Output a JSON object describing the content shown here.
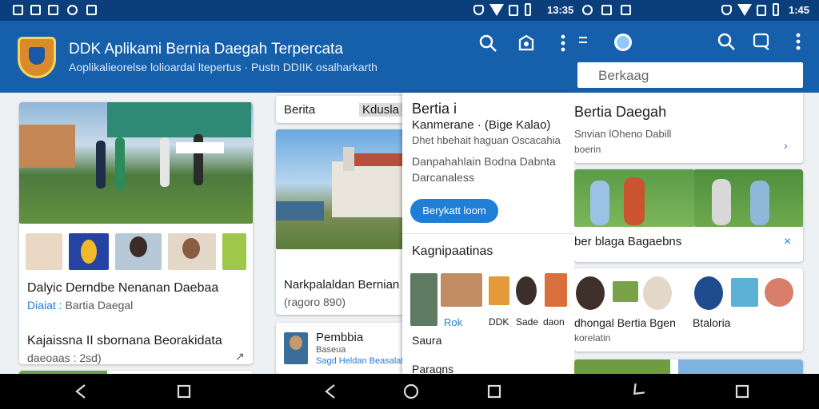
{
  "status_bar": {
    "time_mid": "13:35",
    "time_right": "1:45"
  },
  "panel1": {
    "app_title": "DDK Aplikami Bernia Daegah Terpercata",
    "app_subtitle": "Aoplikalieorelse lolioardal ltepertus · Pustn DDIIK osalharkarth",
    "card1": {
      "title": "Dalyic Derndbe Nenanan Daebaa",
      "meta_label": "Diaiat :",
      "meta_value": "Bartia Daegal"
    },
    "card2": {
      "title": "Kajaissna II sbornana Beorakidata",
      "meta": "daeoaas : 2sd)"
    }
  },
  "panel2": {
    "tabs": [
      {
        "label": "Berita"
      },
      {
        "label": "Kdusla"
      }
    ],
    "card1": {
      "title": "Narkpalaldan Bernian",
      "meta": "(ragoro  890)"
    },
    "card2": {
      "title": "Pembbia",
      "sub1": "Baseua",
      "sub2": "Sagd Heldan Beasalata"
    }
  },
  "panel3_drawer": {
    "title": "Bertia i",
    "subtitle": "Kanmerane · (Bige Kalao)",
    "line1": "Dhet hbehait haguan Oscacahia",
    "line2": "Danpahahlain Bodna Dabnta",
    "line3": "Darcanaless",
    "button_label": "Berykatt loom",
    "section_title": "Kagnipaatinas",
    "items": [
      {
        "label": ""
      },
      {
        "label": "Rok"
      },
      {
        "label": "DDK"
      },
      {
        "label": "Sade"
      },
      {
        "label": "daon"
      }
    ],
    "footer1": "Saura",
    "footer2": "Paragns"
  },
  "panel4": {
    "search_placeholder": "Berkaag",
    "card1": {
      "title": "Bertia Daegah",
      "line1": "Snvian  lOheno Dabill",
      "line2": "boerin"
    },
    "card2": {
      "title": "ber blaga Bagaebns"
    },
    "card3": {
      "title": "dhongal Bertia Bgen",
      "title2": "Btaloria",
      "sub": "korelatin"
    }
  },
  "colors": {
    "appbar": "#1660ab",
    "statusbar": "#0b3f7c",
    "accent": "#1f7fd6",
    "button": "#1f7fd6"
  }
}
